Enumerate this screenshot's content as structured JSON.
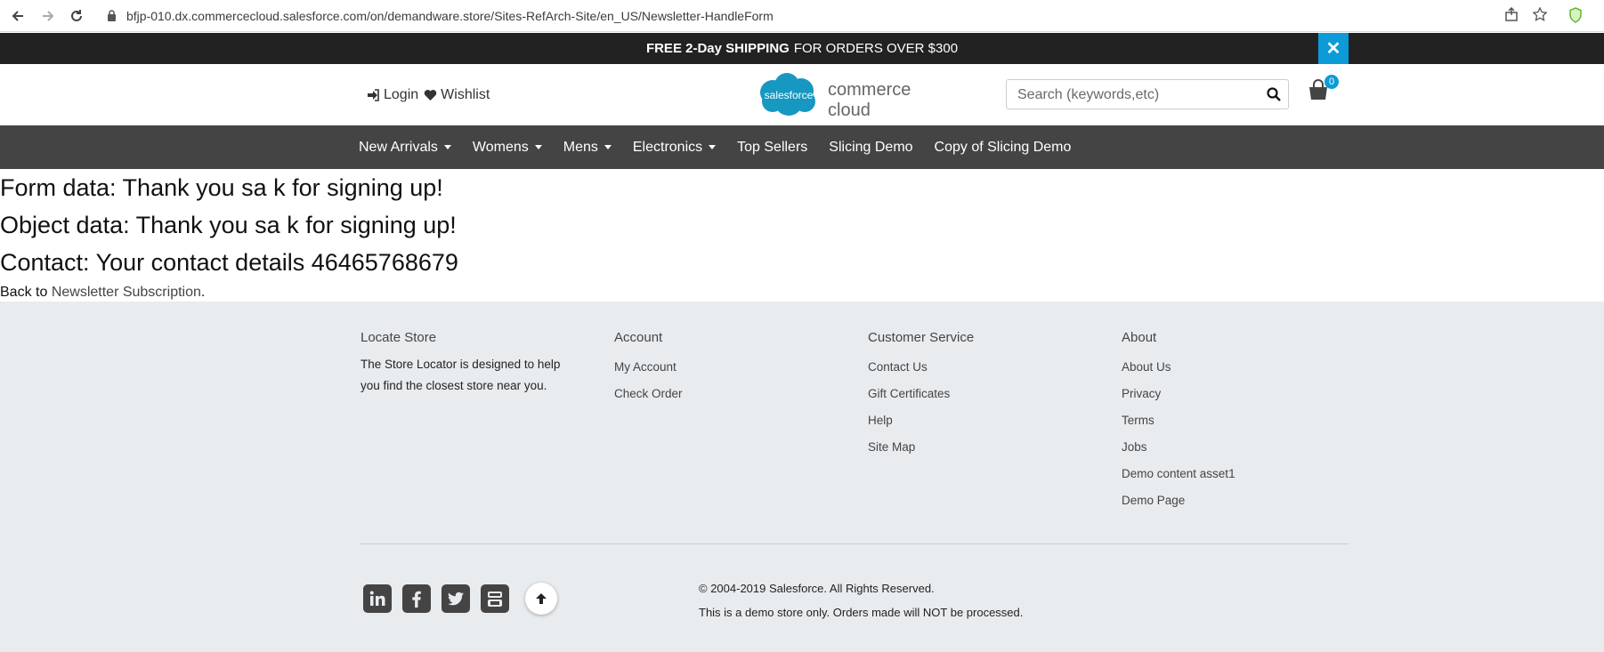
{
  "browser": {
    "url": "bfjp-010.dx.commercecloud.salesforce.com/on/demandware.store/Sites-RefArch-Site/en_US/Newsletter-HandleForm"
  },
  "promo": {
    "bold": "FREE 2-Day SHIPPING",
    "rest": "FOR ORDERS OVER $300"
  },
  "header": {
    "login": "Login",
    "wishlist": "Wishlist",
    "logo_badge": "salesforce",
    "logo_text": "commerce cloud",
    "search_placeholder": "Search (keywords,etc)",
    "cart_count": "0"
  },
  "menu": [
    {
      "label": "New Arrivals",
      "dropdown": true
    },
    {
      "label": "Womens",
      "dropdown": true
    },
    {
      "label": "Mens",
      "dropdown": true
    },
    {
      "label": "Electronics",
      "dropdown": true
    },
    {
      "label": "Top Sellers",
      "dropdown": false
    },
    {
      "label": "Slicing Demo",
      "dropdown": false
    },
    {
      "label": "Copy of Slicing Demo",
      "dropdown": false
    }
  ],
  "main": {
    "form_data": "Form data: Thank you sa k for signing up!",
    "object_data": "Object data: Thank you sa k for signing up!",
    "contact": "Contact: Your contact details 46465768679",
    "back_prefix": "Back to ",
    "back_link": "Newsletter Subscription",
    "back_suffix": "."
  },
  "footer": {
    "locate": {
      "title": "Locate Store",
      "text": "The Store Locator is designed to help you find the closest store near you."
    },
    "account": {
      "title": "Account",
      "links": [
        "My Account",
        "Check Order"
      ]
    },
    "customer_service": {
      "title": "Customer Service",
      "links": [
        "Contact Us",
        "Gift Certificates",
        "Help",
        "Site Map"
      ]
    },
    "about": {
      "title": "About",
      "links": [
        "About Us",
        "Privacy",
        "Terms",
        "Jobs",
        "Demo content asset1",
        "Demo Page"
      ]
    },
    "copyright": "© 2004-2019 Salesforce. All Rights Reserved.",
    "disclaimer": "This is a demo store only. Orders made will NOT be processed.",
    "social_icons": [
      "linkedin-icon",
      "facebook-icon",
      "twitter-icon",
      "youtube-icon"
    ]
  },
  "colors": {
    "promo_bg": "#222222",
    "accent": "#0c9bd7",
    "menu_bg": "#444444",
    "footer_bg": "#e9ecef"
  }
}
